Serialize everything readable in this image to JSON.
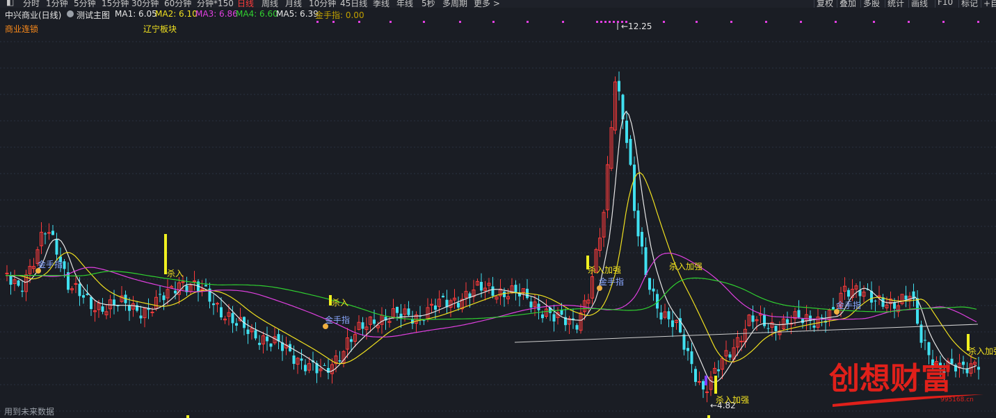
{
  "toolbar": {
    "periods": [
      "分时",
      "1分钟",
      "5分钟",
      "15分钟",
      "30分钟",
      "60分钟",
      "分钟*150",
      "日线",
      "周线",
      "月线",
      "10分钟",
      "45日线",
      "季线",
      "年线",
      "5秒",
      "多周期",
      "更多 >"
    ],
    "active_period": "日线",
    "right_tools": [
      "复权",
      "叠加",
      "多股",
      "统计",
      "画线",
      "F10",
      "标记",
      "+自"
    ]
  },
  "header": {
    "stock_name": "中兴商业(日线)",
    "indicator_name": "测试主图",
    "ma": [
      {
        "label": "MA1:",
        "value": "6.05",
        "color": "#e6e6e6"
      },
      {
        "label": "MA2:",
        "value": "6.10",
        "color": "#f0e020"
      },
      {
        "label": "MA3:",
        "value": "6.86",
        "color": "#e040e0"
      },
      {
        "label": "MA4:",
        "value": "6.60",
        "color": "#30d030"
      },
      {
        "label": "MA5:",
        "value": "6.39",
        "color": "#e6e6e6"
      }
    ],
    "gold_label": "金手指:",
    "gold_value": "0.00",
    "gold_color": "#c0a000"
  },
  "tags": {
    "sector1": "商业连锁",
    "sector2": "辽宁板块"
  },
  "annotations": {
    "high": "12.25",
    "low": "4.82",
    "buy": "杀入",
    "buy_strong": "杀入加强",
    "gold_finger": "金手指"
  },
  "footer": {
    "note": "用到未来数据"
  },
  "logo": {
    "text": "创想财富",
    "url": "995168.cn"
  },
  "colors": {
    "up": "#ff3b3b",
    "down": "#40e0f0",
    "bg": "#1a1d24",
    "grid": "#2a3140",
    "ma1": "#e6e6e6",
    "ma2": "#f0e020",
    "ma3": "#e040e0",
    "ma4": "#30d030"
  }
}
